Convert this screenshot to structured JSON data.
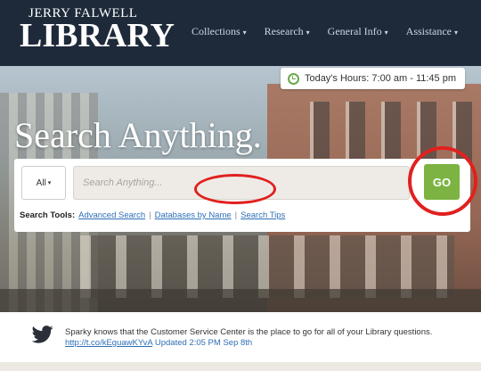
{
  "header": {
    "logo_top": "JERRY FALWELL",
    "logo_main": "LIBRARY",
    "nav": [
      {
        "label": "Collections",
        "caret": "▾"
      },
      {
        "label": "Research",
        "caret": "▾"
      },
      {
        "label": "General Info",
        "caret": "▾"
      },
      {
        "label": "Assistance",
        "caret": "▾"
      }
    ]
  },
  "hero": {
    "hours": "Today's Hours: 7:00 am - 11:45 pm",
    "headline": "Search Anything.",
    "search": {
      "scope_label": "All",
      "scope_caret": "▾",
      "placeholder": "Search Anything...",
      "go_label": "GO"
    },
    "tools": {
      "label": "Search Tools:",
      "links": [
        "Advanced Search",
        "Databases by Name",
        "Search Tips"
      ],
      "separator": "|"
    }
  },
  "twitter": {
    "icon": "twitter-bird-icon",
    "text": "Sparky knows that the Customer Service Center is the place to go for all of your Library questions.",
    "link": "http://t.co/kEguawKYvA",
    "time": "Updated 2:05 PM Sep 8th"
  },
  "colors": {
    "header_bg": "#1e2a3a",
    "go_green": "#7cb342",
    "highlight_red": "#e0211f",
    "link_blue": "#2f6fb6"
  }
}
